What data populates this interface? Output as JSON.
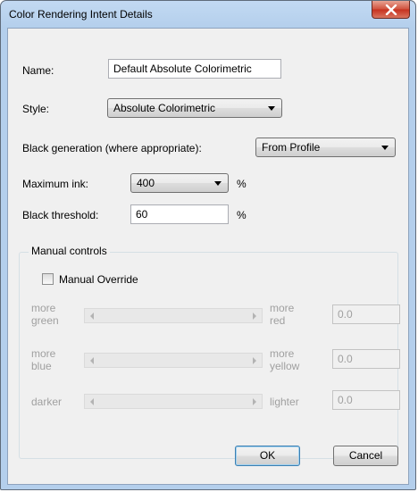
{
  "window": {
    "title": "Color Rendering Intent Details"
  },
  "form": {
    "name_label": "Name:",
    "name_value": "Default Absolute Colorimetric",
    "style_label": "Style:",
    "style_value": "Absolute Colorimetric",
    "black_gen_label": "Black generation (where appropriate):",
    "black_gen_value": "From Profile",
    "max_ink_label": "Maximum ink:",
    "max_ink_value": "400",
    "max_ink_unit": "%",
    "black_threshold_label": "Black threshold:",
    "black_threshold_value": "60",
    "black_threshold_unit": "%"
  },
  "manual": {
    "group_title": "Manual controls",
    "override_label": "Manual Override",
    "override_checked": false,
    "rows": [
      {
        "left_line1": "more",
        "left_line2": "green",
        "right_line1": "more",
        "right_line2": "red",
        "value": "0.0"
      },
      {
        "left_line1": "more",
        "left_line2": "blue",
        "right_line1": "more",
        "right_line2": "yellow",
        "value": "0.0"
      },
      {
        "left_line1": "darker",
        "left_line2": "",
        "right_line1": "lighter",
        "right_line2": "",
        "value": "0.0"
      }
    ]
  },
  "buttons": {
    "ok": "OK",
    "cancel": "Cancel"
  },
  "colors": {
    "titlebar": "#b4cfec",
    "close_button": "#c7301e",
    "client_bg": "#f0f0f0",
    "default_button_border": "#3c7fb1"
  }
}
